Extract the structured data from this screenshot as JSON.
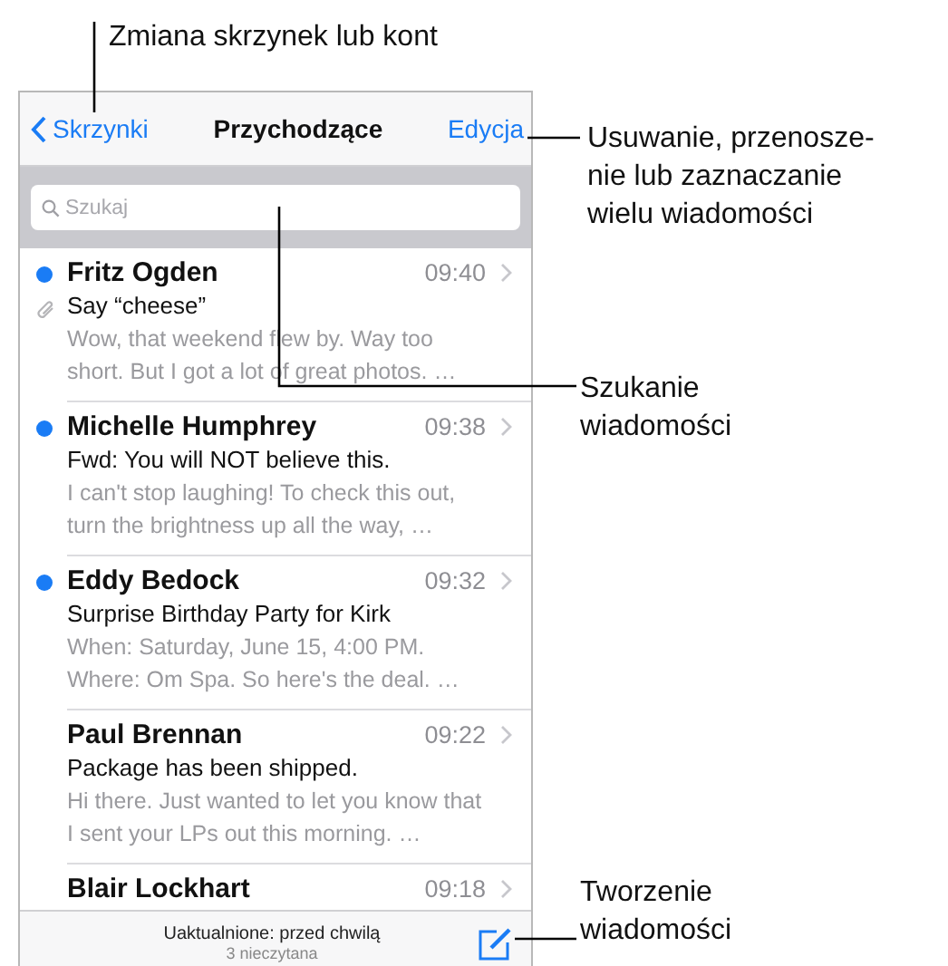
{
  "nav_bar": {
    "back": "Skrzynki",
    "title": "Przychodzące",
    "action": "Edycja"
  },
  "search": {
    "placeholder": "Szukaj"
  },
  "messages": [
    {
      "sender": "Fritz Ogden",
      "time": "09:40",
      "subject": "Say “cheese”",
      "preview": "Wow, that weekend flew by. Way too short. But I got a lot of great photos. …",
      "unread": true,
      "attachment": true
    },
    {
      "sender": "Michelle Humphrey",
      "time": "09:38",
      "subject": "Fwd: You will NOT believe this.",
      "preview": "I can't stop laughing! To check this out, turn the brightness up all the way, …",
      "unread": true,
      "attachment": false
    },
    {
      "sender": "Eddy Bedock",
      "time": "09:32",
      "subject": "Surprise Birthday Party for Kirk",
      "preview": "When: Saturday, June 15, 4:00 PM. Where: Om Spa. So here's the deal. …",
      "unread": true,
      "attachment": false
    },
    {
      "sender": "Paul Brennan",
      "time": "09:22",
      "subject": "Package has been shipped.",
      "preview": "Hi there. Just wanted to let you know that I sent your LPs out this morning. …",
      "unread": false,
      "attachment": false
    },
    {
      "sender": "Blair Lockhart",
      "time": "09:18",
      "unread": false,
      "attachment": false
    }
  ],
  "toolbar": {
    "status": "Uaktualnione: przed chwilą",
    "unread_count": "3 nieczytana"
  },
  "callouts": [
    {
      "kind": "top",
      "text": "Zmiana skrzynek lub kont"
    },
    {
      "kind": "edit",
      "text": "Usuwanie, przenosze-\nnie lub zaznaczanie\nwielu wiadomości"
    },
    {
      "kind": "search",
      "text": "Szukanie\nwiadomości"
    },
    {
      "kind": "compose",
      "text": "Tworzenie\nwiadomości"
    }
  ]
}
